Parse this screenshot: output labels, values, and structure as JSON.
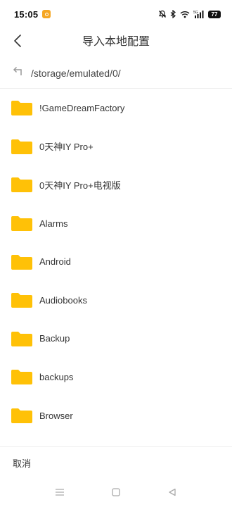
{
  "status_bar": {
    "time": "15:05",
    "battery": "77",
    "icons": [
      "app-notification-icon",
      "mute-icon",
      "bluetooth-icon",
      "wifi-icon",
      "signal-5g-icon",
      "battery-icon"
    ]
  },
  "header": {
    "title": "导入本地配置",
    "back_icon": "chevron-left-icon"
  },
  "path_bar": {
    "up_icon": "return-up-icon",
    "path": "/storage/emulated/0/"
  },
  "files": [
    {
      "name": "!GameDreamFactory",
      "icon": "folder-icon"
    },
    {
      "name": "0天神IY Pro+",
      "icon": "folder-icon"
    },
    {
      "name": "0天神IY Pro+电视版",
      "icon": "folder-icon"
    },
    {
      "name": "Alarms",
      "icon": "folder-icon"
    },
    {
      "name": "Android",
      "icon": "folder-icon"
    },
    {
      "name": "Audiobooks",
      "icon": "folder-icon"
    },
    {
      "name": "Backup",
      "icon": "folder-icon"
    },
    {
      "name": "backups",
      "icon": "folder-icon"
    },
    {
      "name": "Browser",
      "icon": "folder-icon"
    },
    {
      "name": "",
      "icon": "folder-icon"
    }
  ],
  "bottom_bar": {
    "cancel_label": "取消"
  },
  "nav_bar": {
    "icons": [
      "menu-icon",
      "home-icon",
      "back-triangle-icon"
    ]
  },
  "colors": {
    "folder": "#FFC107",
    "background": "#FFFFFF",
    "divider": "#EEEEEE",
    "text": "#333333",
    "app_badge": "#F5A623"
  }
}
